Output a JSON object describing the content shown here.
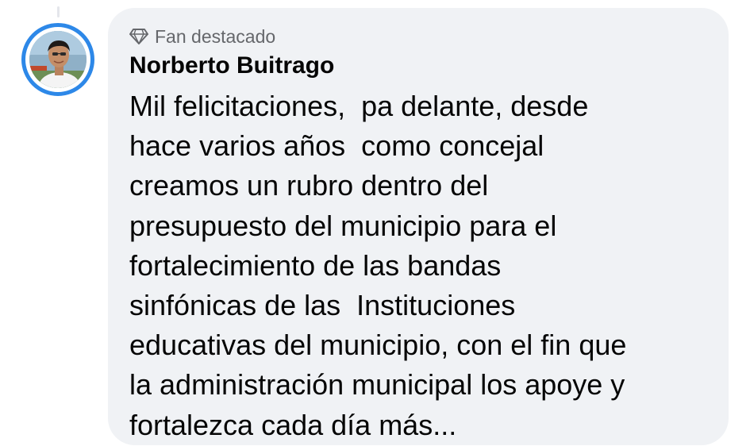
{
  "comment": {
    "badge_label": "Fan destacado",
    "badge_icon": "diamond-icon",
    "author_name": "Norberto Buitrago",
    "avatar_ring_color": "#2d88e8",
    "bubble_color": "#f0f2f5",
    "text_lines": [
      "Mil felicitaciones,  pa delante, desde",
      "hace varios años  como concejal",
      "creamos un rubro dentro del",
      "presupuesto del municipio para el",
      "fortalecimiento de las bandas",
      "sinfónicas de las  Instituciones",
      "educativas del municipio, con el fin que",
      "la administración municipal los apoye y",
      "fortalezca cada día más..."
    ]
  }
}
